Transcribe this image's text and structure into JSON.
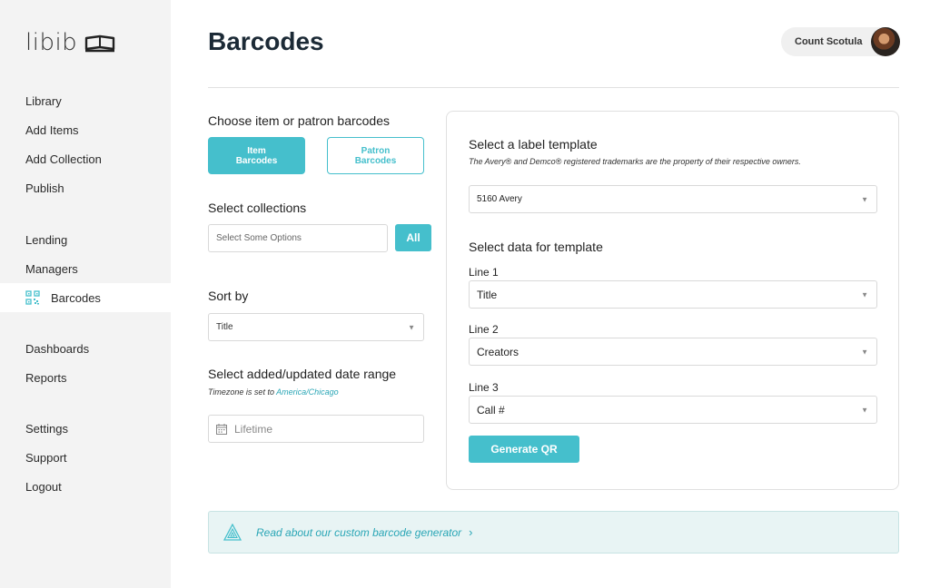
{
  "app": {
    "logo_text": "libib"
  },
  "sidebar": {
    "items": [
      {
        "label": "Library"
      },
      {
        "label": "Add Items"
      },
      {
        "label": "Add Collection"
      },
      {
        "label": "Publish"
      },
      {
        "label": "Lending"
      },
      {
        "label": "Managers"
      },
      {
        "label": "Barcodes",
        "active": true,
        "icon": "barcode-qr-icon"
      },
      {
        "label": "Dashboards"
      },
      {
        "label": "Reports"
      },
      {
        "label": "Settings"
      },
      {
        "label": "Support"
      },
      {
        "label": "Logout"
      }
    ]
  },
  "header": {
    "title": "Barcodes",
    "user_name": "Count Scotula"
  },
  "left": {
    "choose_label": "Choose item or patron barcodes",
    "item_barcodes_line1": "Item",
    "item_barcodes_line2": "Barcodes",
    "patron_barcodes_line1": "Patron",
    "patron_barcodes_line2": "Barcodes",
    "collections_label": "Select collections",
    "collections_placeholder": "Select Some Options",
    "all_button": "All",
    "sort_label": "Sort by",
    "sort_value": "Title",
    "date_label": "Select added/updated date range",
    "timezone_prefix": "Timezone is set to",
    "timezone_value": "America/Chicago",
    "date_value": "Lifetime"
  },
  "panel": {
    "template_label": "Select a label template",
    "trademark_note": "The Avery® and Demco® registered trademarks are the property of their respective owners.",
    "template_value": "5160 Avery",
    "data_label": "Select data for template",
    "line1_label": "Line 1",
    "line1_value": "Title",
    "line2_label": "Line 2",
    "line2_value": "Creators",
    "line3_label": "Line 3",
    "line3_value": "Call #",
    "generate_button": "Generate QR"
  },
  "banner": {
    "link_text": "Read about our custom barcode generator",
    "chevron": "›"
  },
  "colors": {
    "accent": "#45bfcc",
    "sidebar_bg": "#f3f3f3",
    "title": "#1c2a36"
  }
}
